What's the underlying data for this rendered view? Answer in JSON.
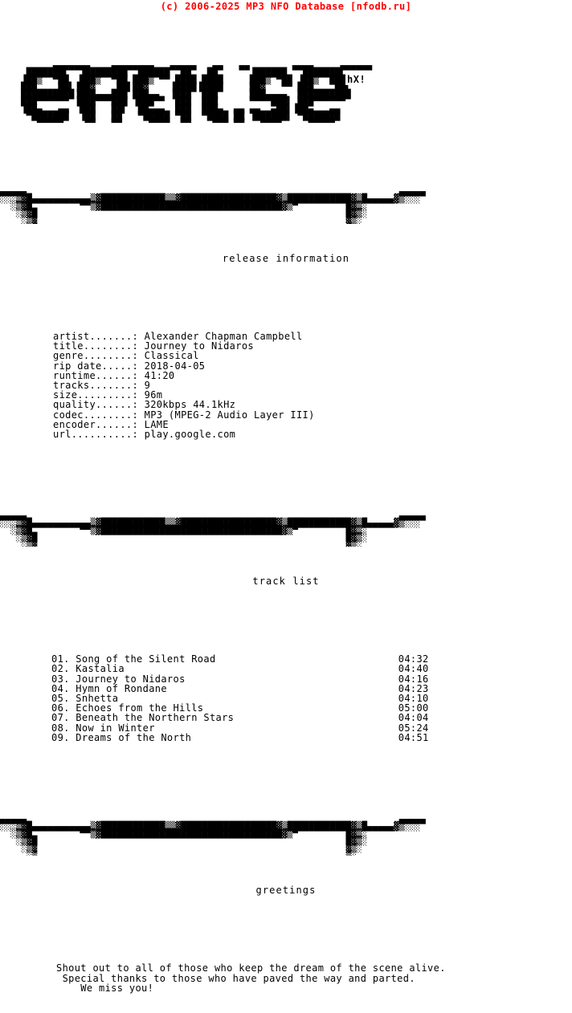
{
  "header": {
    "copyright": "(c) 2006-2025 MP3 NFO Database [nfodb.ru]",
    "copyright_color": "#FF0000"
  },
  "logo": {
    "text": "entitled",
    "signature": "hX!",
    "ascii": "  ▄▄▄▄▄▄▄    ▄▄▄▄▄▄▄▄   ▄▄▄▄▄   ▄▄   ▄▄        ▄▄▄▄     ▄▄▄▄▄▄\n ███████▌  ▐████████  ██████  ██   ██      ▐██████   ███████▌\n▐██▒  ▀██  ███▒  ▀██ ███▒ ▀▀ ████ ████     ███▒ ▀██ ▐██▒  ███\n███    ██▌▐██▓    ██▌██▓    ▐████▐████     ██▓   ▀▀ ███    ██▌\n██████████▐███▄▄▄███ ███▄▄  ▐███  ███      ███▄▄▄▄  ██████████\n███▀▀▀▀▀▀ ▐███▀▀▀███ ▐███▀▀  ███  ███      ▀▀▀▀███▌ ███▀▀▀▀▀▀\n▐██▄   ▄▄  ███   ██▌  ██▄▄▄  ███  ███▄  ▄▄ ▄▄  ▄██▌▐██▄   ▄▄\n ▀███████  ▐██   ██   ▀█████ ▀██  ▀████ ██ ▐██████▌ ▀███████\n   ▀▀▀▀▀    ▀▀   ▀▀     ▀▀▀▀  ▀▀    ▀▀▀ ▀▀   ▀▀▀▀     ▀▀▀▀▀"
  },
  "separator": {
    "ascii": "▄▄▄▄▄                                                                      ▄▄▄▄▄\n░░░▒▓█▄▄▄▄▄▄▄▄▄▄▄▒▓████████████▒▒▓██████████████████▓▒████████████▓▒█▄▄▄▄▄▓▒░░░\n  ░▒▓█         ▀▀▒▓██████████████████████████████████▓▒▀         █▓▒░\n   ░▒▓█                                                          █▓▒░\n    ░▒▓                                                          ▓▒░\n     ░▒                                                          ▒░"
  },
  "rail": {
    "left": "░▒▓█\n░▒▓\n ░▒\n ░",
    "right": "█▓▒░\n ▓▒░\n ▒░\n ░"
  },
  "sections": {
    "release_information": {
      "title": "release information",
      "fields": [
        {
          "label": "artist",
          "value": "Alexander Chapman Campbell"
        },
        {
          "label": "title",
          "value": "Journey to Nidaros"
        },
        {
          "label": "genre",
          "value": "Classical"
        },
        {
          "label": "rip date",
          "value": "2018-04-05"
        },
        {
          "label": "runtime",
          "value": "41:20"
        },
        {
          "label": "tracks",
          "value": "9"
        },
        {
          "label": "size",
          "value": "96m"
        },
        {
          "label": "quality",
          "value": "320kbps 44.1kHz"
        },
        {
          "label": "codec",
          "value": "MP3 (MPEG-2 Audio Layer III)"
        },
        {
          "label": "encoder",
          "value": "LAME"
        },
        {
          "label": "url",
          "value": "play.google.com"
        }
      ]
    },
    "track_list": {
      "title": "track list",
      "tracks": [
        {
          "num": "01.",
          "name": "Song of the Silent Road",
          "time": "04:32"
        },
        {
          "num": "02.",
          "name": "Kastalia",
          "time": "04:40"
        },
        {
          "num": "03.",
          "name": "Journey to Nidaros",
          "time": "04:16"
        },
        {
          "num": "04.",
          "name": "Hymn of Rondane",
          "time": "04:23"
        },
        {
          "num": "05.",
          "name": "Snhetta",
          "time": "04:10"
        },
        {
          "num": "06.",
          "name": "Echoes from the Hills",
          "time": "05:00"
        },
        {
          "num": "07.",
          "name": "Beneath the Northern Stars",
          "time": "04:04"
        },
        {
          "num": "08.",
          "name": "Now in Winter",
          "time": "05:24"
        },
        {
          "num": "09.",
          "name": "Dreams of the North",
          "time": "04:51"
        }
      ]
    },
    "greetings": {
      "title": "greetings",
      "lines": [
        "Shout out to all of those who keep the dream of the scene alive.",
        " Special thanks to those who have paved the way and parted.",
        "    We miss you!"
      ]
    }
  }
}
